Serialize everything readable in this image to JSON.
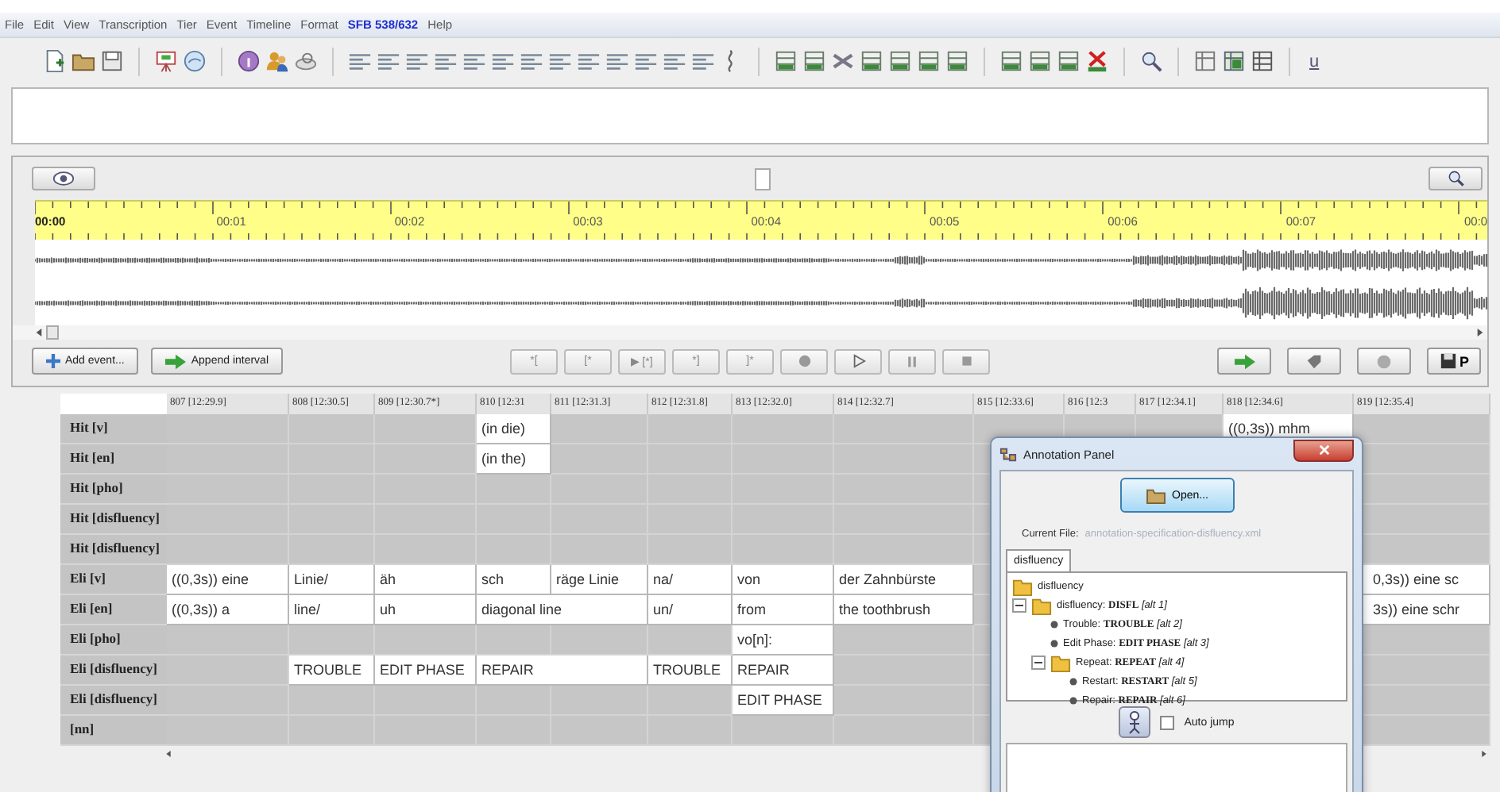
{
  "menu": [
    {
      "label": "File",
      "highlighted": false
    },
    {
      "label": "Edit",
      "highlighted": false
    },
    {
      "label": "View",
      "highlighted": false
    },
    {
      "label": "Transcription",
      "highlighted": false
    },
    {
      "label": "Tier",
      "highlighted": false
    },
    {
      "label": "Event",
      "highlighted": false
    },
    {
      "label": "Timeline",
      "highlighted": false
    },
    {
      "label": "Format",
      "highlighted": false
    },
    {
      "label": "SFB 538/632",
      "highlighted": true
    },
    {
      "label": "Help",
      "highlighted": false
    }
  ],
  "toolbar": {
    "underline_label": "u"
  },
  "timeline": {
    "ticks": [
      "00:00",
      "00:01",
      "00:02",
      "00:03",
      "00:04",
      "00:05",
      "00:06",
      "00:07",
      "00:0"
    ]
  },
  "actions": {
    "add_event": "Add event...",
    "append_interval": "Append interval"
  },
  "transport": [
    "*[",
    "[*",
    "▶ [*]",
    "*]",
    "]*"
  ],
  "mode_button": {
    "label": "P"
  },
  "table": {
    "columns": [
      "807 [12:29.9]",
      "808 [12:30.5]",
      "809 [12:30.7*]",
      "810 [12:31",
      "811 [12:31.3]",
      "812 [12:31.8]",
      "813 [12:32.0]",
      "814 [12:32.7]",
      "815 [12:33.6]",
      "816 [12:3",
      "817 [12:34.1]",
      "818 [12:34.6]",
      "819 [12:35.4]"
    ],
    "rows": [
      {
        "label": "Hit [v]",
        "cells": [
          {
            "kind": "empty"
          },
          {
            "kind": "empty"
          },
          {
            "kind": "empty"
          },
          {
            "kind": "text",
            "text": "(in die)"
          },
          {
            "kind": "empty"
          },
          {
            "kind": "empty"
          },
          {
            "kind": "empty"
          },
          {
            "kind": "empty"
          },
          {
            "kind": "empty"
          },
          {
            "kind": "empty"
          },
          {
            "kind": "empty"
          },
          {
            "kind": "text",
            "text": "((0,3s)) mhm"
          },
          {
            "kind": "empty"
          }
        ]
      },
      {
        "label": "Hit [en]",
        "cells": [
          {
            "kind": "empty"
          },
          {
            "kind": "empty"
          },
          {
            "kind": "empty"
          },
          {
            "kind": "text",
            "text": "(in the)"
          },
          {
            "kind": "empty"
          },
          {
            "kind": "empty"
          },
          {
            "kind": "empty"
          },
          {
            "kind": "empty"
          },
          {
            "kind": "empty"
          },
          {
            "kind": "covered"
          },
          {
            "kind": "covered"
          },
          {
            "kind": "covered"
          },
          {
            "kind": "empty"
          }
        ]
      },
      {
        "label": "Hit [pho]",
        "cells": [
          {
            "kind": "empty"
          },
          {
            "kind": "empty"
          },
          {
            "kind": "empty"
          },
          {
            "kind": "empty"
          },
          {
            "kind": "empty"
          },
          {
            "kind": "empty"
          },
          {
            "kind": "empty"
          },
          {
            "kind": "empty"
          },
          {
            "kind": "empty"
          },
          {
            "kind": "covered"
          },
          {
            "kind": "covered"
          },
          {
            "kind": "covered"
          },
          {
            "kind": "empty"
          }
        ]
      },
      {
        "label": "Hit [disfluency]",
        "cells": [
          {
            "kind": "empty"
          },
          {
            "kind": "empty"
          },
          {
            "kind": "empty"
          },
          {
            "kind": "empty"
          },
          {
            "kind": "empty"
          },
          {
            "kind": "empty"
          },
          {
            "kind": "empty"
          },
          {
            "kind": "empty"
          },
          {
            "kind": "empty"
          },
          {
            "kind": "covered"
          },
          {
            "kind": "covered"
          },
          {
            "kind": "covered"
          },
          {
            "kind": "empty"
          }
        ]
      },
      {
        "label": "Hit [disfluency]",
        "cells": [
          {
            "kind": "empty"
          },
          {
            "kind": "empty"
          },
          {
            "kind": "empty"
          },
          {
            "kind": "empty"
          },
          {
            "kind": "empty"
          },
          {
            "kind": "empty"
          },
          {
            "kind": "empty"
          },
          {
            "kind": "empty"
          },
          {
            "kind": "empty"
          },
          {
            "kind": "covered"
          },
          {
            "kind": "covered"
          },
          {
            "kind": "covered"
          },
          {
            "kind": "empty"
          }
        ]
      },
      {
        "label": "Eli [v]",
        "cells": [
          {
            "kind": "text",
            "text": "((0,3s)) eine"
          },
          {
            "kind": "text",
            "text": "Linie/"
          },
          {
            "kind": "text",
            "text": "äh"
          },
          {
            "kind": "text",
            "text": "sch"
          },
          {
            "kind": "text",
            "text": "räge Linie"
          },
          {
            "kind": "text",
            "text": "na/"
          },
          {
            "kind": "text",
            "text": "von"
          },
          {
            "kind": "text",
            "text": "der Zahnbürste"
          },
          {
            "kind": "empty"
          },
          {
            "kind": "covered"
          },
          {
            "kind": "covered"
          },
          {
            "kind": "covered"
          },
          {
            "kind": "text",
            "text": "0,3s)) eine sc"
          }
        ]
      },
      {
        "label": "Eli [en]",
        "cells": [
          {
            "kind": "text",
            "text": "((0,3s)) a"
          },
          {
            "kind": "text",
            "text": "line/"
          },
          {
            "kind": "text",
            "text": "uh"
          },
          {
            "kind": "wide",
            "text": "diagonal line"
          },
          {
            "kind": "spanned"
          },
          {
            "kind": "text",
            "text": "un/"
          },
          {
            "kind": "text",
            "text": "from"
          },
          {
            "kind": "text",
            "text": "the toothbrush"
          },
          {
            "kind": "empty"
          },
          {
            "kind": "covered"
          },
          {
            "kind": "covered"
          },
          {
            "kind": "covered"
          },
          {
            "kind": "text",
            "text": "3s)) eine schr"
          }
        ]
      },
      {
        "label": "Eli [pho]",
        "cells": [
          {
            "kind": "empty"
          },
          {
            "kind": "empty"
          },
          {
            "kind": "empty"
          },
          {
            "kind": "empty"
          },
          {
            "kind": "empty"
          },
          {
            "kind": "empty"
          },
          {
            "kind": "text",
            "text": "vo[n]:"
          },
          {
            "kind": "empty"
          },
          {
            "kind": "empty"
          },
          {
            "kind": "covered"
          },
          {
            "kind": "covered"
          },
          {
            "kind": "covered"
          },
          {
            "kind": "empty"
          }
        ]
      },
      {
        "label": "Eli [disfluency]",
        "cells": [
          {
            "kind": "empty"
          },
          {
            "kind": "text",
            "text": "TROUBLE"
          },
          {
            "kind": "text",
            "text": "EDIT PHASE"
          },
          {
            "kind": "wide",
            "text": "REPAIR"
          },
          {
            "kind": "spanned"
          },
          {
            "kind": "text",
            "text": "TROUBLE"
          },
          {
            "kind": "text",
            "text": "REPAIR"
          },
          {
            "kind": "empty"
          },
          {
            "kind": "empty"
          },
          {
            "kind": "covered"
          },
          {
            "kind": "covered"
          },
          {
            "kind": "covered"
          },
          {
            "kind": "empty"
          }
        ]
      },
      {
        "label": "Eli [disfluency]",
        "cells": [
          {
            "kind": "empty"
          },
          {
            "kind": "empty"
          },
          {
            "kind": "empty"
          },
          {
            "kind": "empty"
          },
          {
            "kind": "empty"
          },
          {
            "kind": "empty"
          },
          {
            "kind": "text",
            "text": "EDIT PHASE"
          },
          {
            "kind": "empty"
          },
          {
            "kind": "empty"
          },
          {
            "kind": "covered"
          },
          {
            "kind": "covered"
          },
          {
            "kind": "covered"
          },
          {
            "kind": "empty"
          }
        ]
      },
      {
        "label": "[nn]",
        "cells": [
          {
            "kind": "empty"
          },
          {
            "kind": "empty"
          },
          {
            "kind": "empty"
          },
          {
            "kind": "empty"
          },
          {
            "kind": "empty"
          },
          {
            "kind": "empty"
          },
          {
            "kind": "empty"
          },
          {
            "kind": "empty"
          },
          {
            "kind": "empty"
          },
          {
            "kind": "covered"
          },
          {
            "kind": "covered"
          },
          {
            "kind": "covered"
          },
          {
            "kind": "empty"
          }
        ]
      }
    ]
  },
  "annotation_panel": {
    "title": "Annotation Panel",
    "open_button": "Open...",
    "current_file_label": "Current File:",
    "current_file": "annotation-specification-disfluency.xml",
    "tabs": [
      {
        "label": "disfluency",
        "selected": true
      }
    ],
    "tree": [
      {
        "kind": "folder",
        "text": "disfluency",
        "children": [
          {
            "kind": "folder",
            "text": "disfluency: **DISFL** *[alt 1]*",
            "expanded": true,
            "children": [
              {
                "kind": "leaf",
                "text": "Trouble: **TROUBLE** *[alt 2]*"
              },
              {
                "kind": "leaf",
                "text": "Edit Phase: **EDIT PHASE** *[alt 3]*"
              },
              {
                "kind": "folder",
                "text": "Repeat: **REPEAT** *[alt 4]*",
                "expanded": true,
                "children": [
                  {
                    "kind": "leaf",
                    "text": "Restart: **RESTART** *[alt 5]*"
                  },
                  {
                    "kind": "leaf",
                    "text": "Repair: **REPAIR** *[alt 6]*"
                  }
                ]
              }
            ]
          }
        ]
      }
    ],
    "auto_jump": {
      "label": "Auto jump",
      "checked": false
    }
  }
}
